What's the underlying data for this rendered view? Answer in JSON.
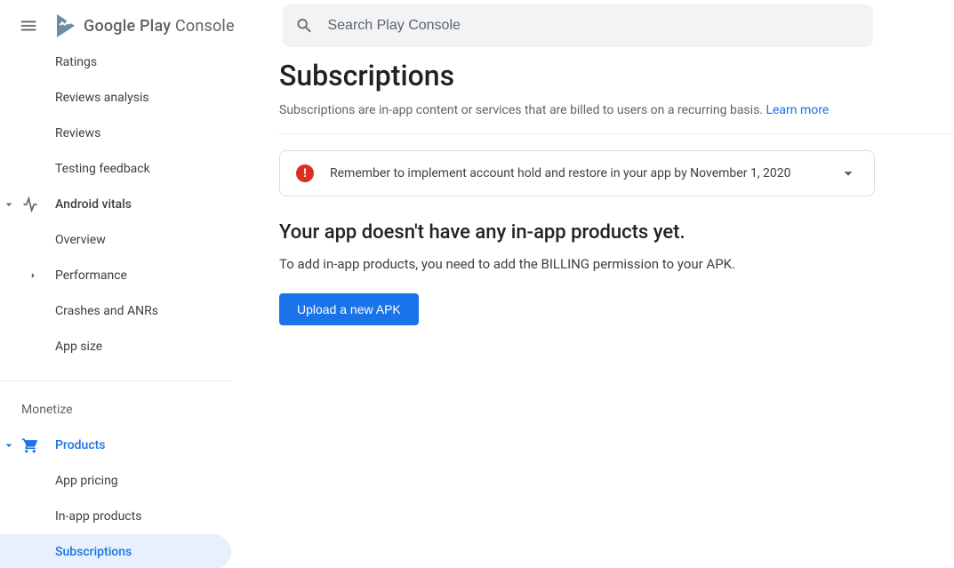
{
  "header": {
    "logo_text_a": "Google Play",
    "logo_text_b": "Console",
    "search_placeholder": "Search Play Console"
  },
  "sidebar": {
    "ratings": "Ratings",
    "reviews_analysis": "Reviews analysis",
    "reviews": "Reviews",
    "testing_feedback": "Testing feedback",
    "android_vitals": "Android vitals",
    "overview": "Overview",
    "performance": "Performance",
    "crashes": "Crashes and ANRs",
    "app_size": "App size",
    "monetize_label": "Monetize",
    "products": "Products",
    "app_pricing": "App pricing",
    "inapp_products": "In-app products",
    "subscriptions": "Subscriptions"
  },
  "main": {
    "title": "Subscriptions",
    "subtitle_text": "Subscriptions are in-app content or services that are billed to users on a recurring basis. ",
    "learn_more": "Learn more",
    "alert_text": "Remember to implement account hold and restore in your app by November 1, 2020",
    "empty_title": "Your app doesn't have any in-app products yet.",
    "empty_desc": "To add in-app products, you need to add the BILLING permission to your APK.",
    "upload_button": "Upload a new APK"
  }
}
